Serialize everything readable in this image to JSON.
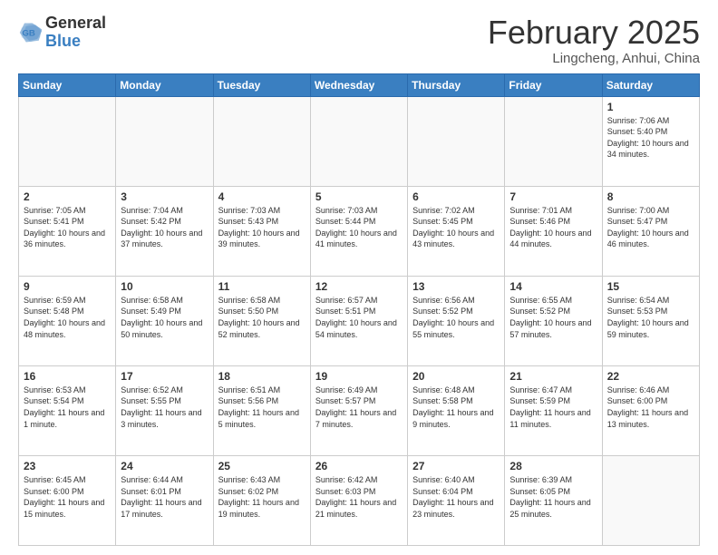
{
  "header": {
    "logo_general": "General",
    "logo_blue": "Blue",
    "month_title": "February 2025",
    "location": "Lingcheng, Anhui, China"
  },
  "weekdays": [
    "Sunday",
    "Monday",
    "Tuesday",
    "Wednesday",
    "Thursday",
    "Friday",
    "Saturday"
  ],
  "weeks": [
    [
      {
        "day": "",
        "info": ""
      },
      {
        "day": "",
        "info": ""
      },
      {
        "day": "",
        "info": ""
      },
      {
        "day": "",
        "info": ""
      },
      {
        "day": "",
        "info": ""
      },
      {
        "day": "",
        "info": ""
      },
      {
        "day": "1",
        "info": "Sunrise: 7:06 AM\nSunset: 5:40 PM\nDaylight: 10 hours\nand 34 minutes."
      }
    ],
    [
      {
        "day": "2",
        "info": "Sunrise: 7:05 AM\nSunset: 5:41 PM\nDaylight: 10 hours\nand 36 minutes."
      },
      {
        "day": "3",
        "info": "Sunrise: 7:04 AM\nSunset: 5:42 PM\nDaylight: 10 hours\nand 37 minutes."
      },
      {
        "day": "4",
        "info": "Sunrise: 7:03 AM\nSunset: 5:43 PM\nDaylight: 10 hours\nand 39 minutes."
      },
      {
        "day": "5",
        "info": "Sunrise: 7:03 AM\nSunset: 5:44 PM\nDaylight: 10 hours\nand 41 minutes."
      },
      {
        "day": "6",
        "info": "Sunrise: 7:02 AM\nSunset: 5:45 PM\nDaylight: 10 hours\nand 43 minutes."
      },
      {
        "day": "7",
        "info": "Sunrise: 7:01 AM\nSunset: 5:46 PM\nDaylight: 10 hours\nand 44 minutes."
      },
      {
        "day": "8",
        "info": "Sunrise: 7:00 AM\nSunset: 5:47 PM\nDaylight: 10 hours\nand 46 minutes."
      }
    ],
    [
      {
        "day": "9",
        "info": "Sunrise: 6:59 AM\nSunset: 5:48 PM\nDaylight: 10 hours\nand 48 minutes."
      },
      {
        "day": "10",
        "info": "Sunrise: 6:58 AM\nSunset: 5:49 PM\nDaylight: 10 hours\nand 50 minutes."
      },
      {
        "day": "11",
        "info": "Sunrise: 6:58 AM\nSunset: 5:50 PM\nDaylight: 10 hours\nand 52 minutes."
      },
      {
        "day": "12",
        "info": "Sunrise: 6:57 AM\nSunset: 5:51 PM\nDaylight: 10 hours\nand 54 minutes."
      },
      {
        "day": "13",
        "info": "Sunrise: 6:56 AM\nSunset: 5:52 PM\nDaylight: 10 hours\nand 55 minutes."
      },
      {
        "day": "14",
        "info": "Sunrise: 6:55 AM\nSunset: 5:52 PM\nDaylight: 10 hours\nand 57 minutes."
      },
      {
        "day": "15",
        "info": "Sunrise: 6:54 AM\nSunset: 5:53 PM\nDaylight: 10 hours\nand 59 minutes."
      }
    ],
    [
      {
        "day": "16",
        "info": "Sunrise: 6:53 AM\nSunset: 5:54 PM\nDaylight: 11 hours\nand 1 minute."
      },
      {
        "day": "17",
        "info": "Sunrise: 6:52 AM\nSunset: 5:55 PM\nDaylight: 11 hours\nand 3 minutes."
      },
      {
        "day": "18",
        "info": "Sunrise: 6:51 AM\nSunset: 5:56 PM\nDaylight: 11 hours\nand 5 minutes."
      },
      {
        "day": "19",
        "info": "Sunrise: 6:49 AM\nSunset: 5:57 PM\nDaylight: 11 hours\nand 7 minutes."
      },
      {
        "day": "20",
        "info": "Sunrise: 6:48 AM\nSunset: 5:58 PM\nDaylight: 11 hours\nand 9 minutes."
      },
      {
        "day": "21",
        "info": "Sunrise: 6:47 AM\nSunset: 5:59 PM\nDaylight: 11 hours\nand 11 minutes."
      },
      {
        "day": "22",
        "info": "Sunrise: 6:46 AM\nSunset: 6:00 PM\nDaylight: 11 hours\nand 13 minutes."
      }
    ],
    [
      {
        "day": "23",
        "info": "Sunrise: 6:45 AM\nSunset: 6:00 PM\nDaylight: 11 hours\nand 15 minutes."
      },
      {
        "day": "24",
        "info": "Sunrise: 6:44 AM\nSunset: 6:01 PM\nDaylight: 11 hours\nand 17 minutes."
      },
      {
        "day": "25",
        "info": "Sunrise: 6:43 AM\nSunset: 6:02 PM\nDaylight: 11 hours\nand 19 minutes."
      },
      {
        "day": "26",
        "info": "Sunrise: 6:42 AM\nSunset: 6:03 PM\nDaylight: 11 hours\nand 21 minutes."
      },
      {
        "day": "27",
        "info": "Sunrise: 6:40 AM\nSunset: 6:04 PM\nDaylight: 11 hours\nand 23 minutes."
      },
      {
        "day": "28",
        "info": "Sunrise: 6:39 AM\nSunset: 6:05 PM\nDaylight: 11 hours\nand 25 minutes."
      },
      {
        "day": "",
        "info": ""
      }
    ]
  ]
}
